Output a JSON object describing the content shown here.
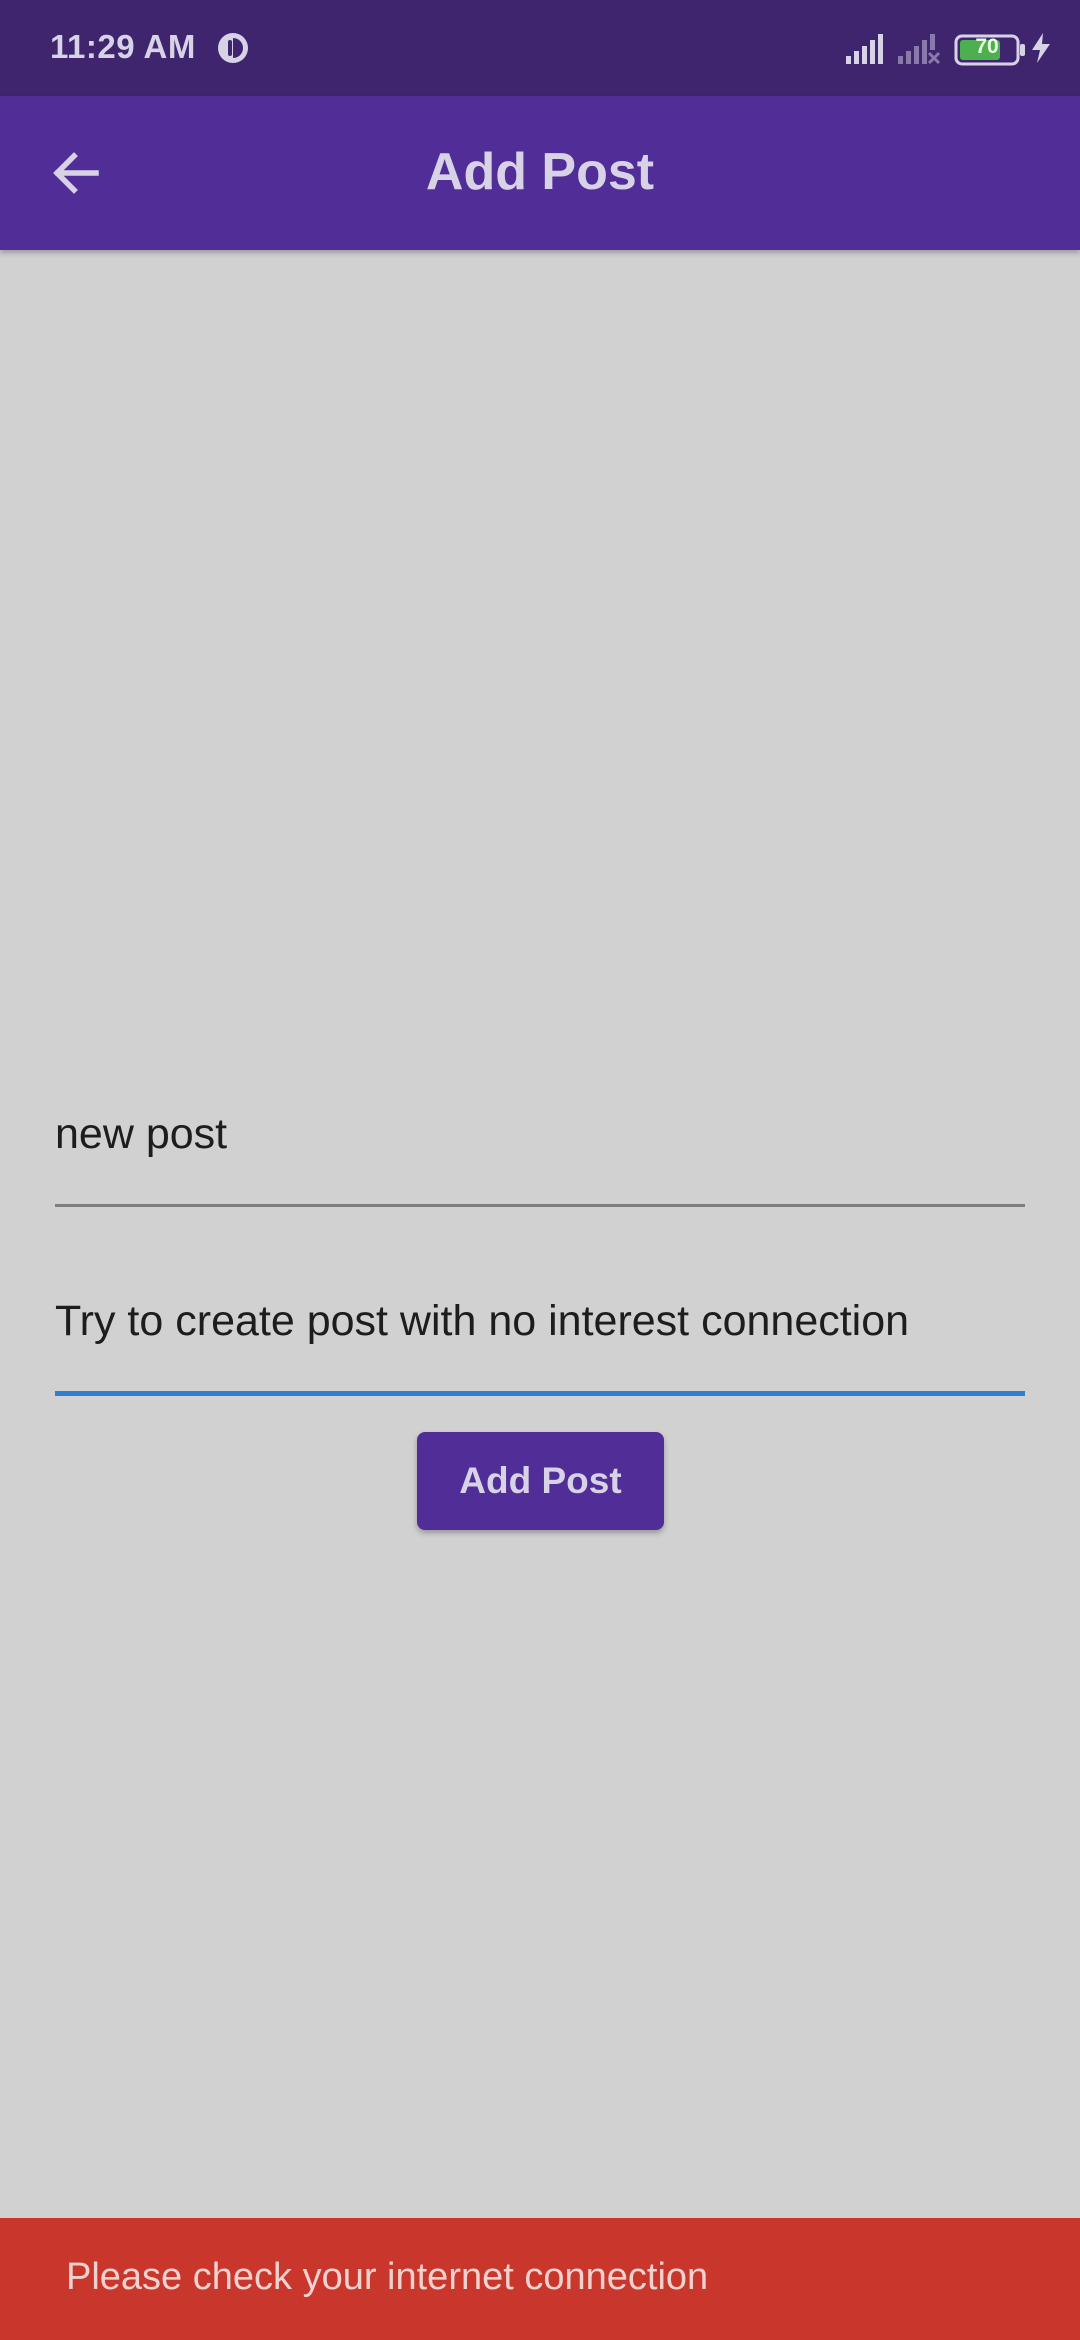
{
  "status_bar": {
    "time": "11:29 AM",
    "app_icon": "circle-app-icon",
    "signal_icon_1": "signal-full-icon",
    "signal_icon_2": "signal-no-sim-icon",
    "battery_level": "70",
    "charging_icon": "lightning-bolt-icon"
  },
  "app_bar": {
    "back_icon": "arrow-back-icon",
    "title": "Add Post",
    "color": "#512e97"
  },
  "form": {
    "title_value": "new post",
    "body_value": "Try to create post with no interest connection",
    "focused_underline_color": "#2f7fcf",
    "submit_label": "Add Post"
  },
  "snackbar": {
    "message": "Please check your internet connection",
    "color": "#c9372c"
  }
}
